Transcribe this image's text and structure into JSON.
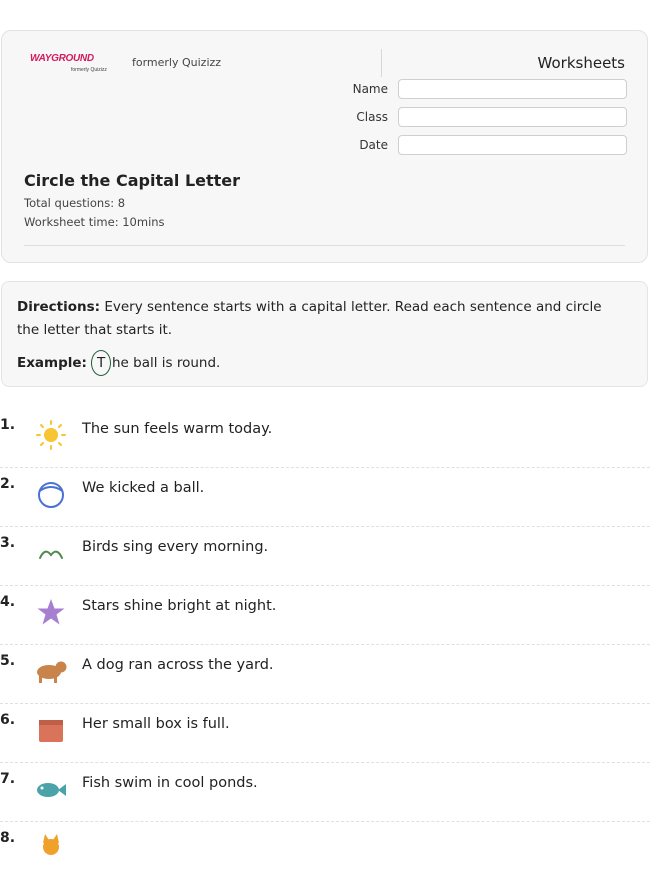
{
  "header": {
    "logo_text": "WAYGROUND",
    "logo_sub": "formerly Quizizz",
    "formerly": "formerly Quizizz",
    "category": "Worksheets",
    "fields": [
      {
        "label": "Name",
        "value": ""
      },
      {
        "label": "Class",
        "value": ""
      },
      {
        "label": "Date",
        "value": ""
      }
    ],
    "title": "Circle the Capital Letter",
    "total_questions": "Total questions: 8",
    "worksheet_time": "Worksheet time: 10mins"
  },
  "directions": {
    "label": "Directions:",
    "text": " Every sentence starts with a capital letter. Read each sentence and circle the letter that starts it.",
    "example_label": "Example:",
    "example_letter": "T",
    "example_rest": "he ball is round."
  },
  "questions": [
    {
      "number": "1.",
      "icon": "sun-icon",
      "text": "The sun feels warm today."
    },
    {
      "number": "2.",
      "icon": "ball-icon",
      "text": "We kicked a ball."
    },
    {
      "number": "3.",
      "icon": "bird-icon",
      "text": "Birds sing every morning."
    },
    {
      "number": "4.",
      "icon": "star-icon",
      "text": "Stars shine bright at night."
    },
    {
      "number": "5.",
      "icon": "dog-icon",
      "text": "A dog ran across the yard."
    },
    {
      "number": "6.",
      "icon": "box-icon",
      "text": "Her small box is full."
    },
    {
      "number": "7.",
      "icon": "fish-icon",
      "text": "Fish swim in cool ponds."
    },
    {
      "number": "8.",
      "icon": "cat-icon",
      "text": ""
    }
  ],
  "colors": {
    "brand": "#d21b5e",
    "example_circle": "#1e5c3a",
    "sun": "#f7c531",
    "ball": "#4a72d4",
    "bird": "#4e8a4e",
    "star": "#a77fd1",
    "dog": "#c8844a",
    "box": "#d9735a",
    "fish": "#4aa3a8",
    "cat": "#f0a12a"
  }
}
